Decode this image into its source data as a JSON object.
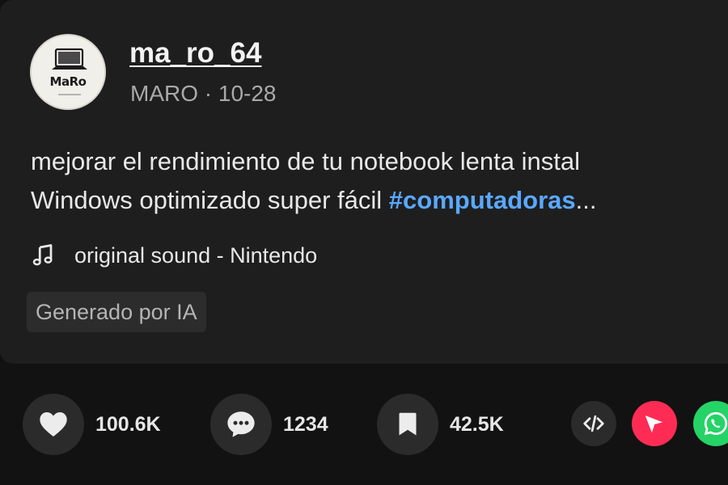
{
  "author": {
    "username": "ma_ro_64",
    "avatar_text": "MaRo",
    "display_name": "MARO",
    "date": "10-28",
    "separator": "·"
  },
  "post": {
    "description_line1": "mejorar el rendimiento de tu notebook lenta instal",
    "description_line2_text": "Windows optimizado super fácil ",
    "hashtag": "#computadoras",
    "ellipsis": "...",
    "sound_icon": "music-note-icon",
    "sound": "original sound - Nintendo",
    "ai_label": "Generado por IA"
  },
  "actions": {
    "likes": {
      "icon": "heart-icon",
      "count": "100.6K"
    },
    "comments": {
      "icon": "comment-icon",
      "count": "1234"
    },
    "saves": {
      "icon": "bookmark-icon",
      "count": "42.5K"
    }
  },
  "share": {
    "embed": {
      "icon": "embed-code-icon",
      "color": "#2b2b2b"
    },
    "send": {
      "icon": "send-icon",
      "color": "#fe2c55"
    },
    "whatsapp": {
      "icon": "whatsapp-icon",
      "color": "#25d366"
    }
  },
  "colors": {
    "background": "#121212",
    "card": "#1e1e1e",
    "hashtag": "#5aa8ff",
    "secondary_text": "#a9a9a9"
  }
}
